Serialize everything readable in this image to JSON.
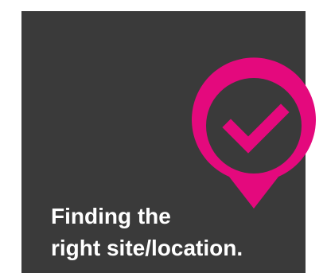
{
  "colors": {
    "card_background": "#3a3a3a",
    "accent": "#e4097d",
    "text": "#ffffff"
  },
  "icon": "location-pin-check-icon",
  "caption": {
    "line1": "Finding the",
    "line2": "right site/location."
  }
}
